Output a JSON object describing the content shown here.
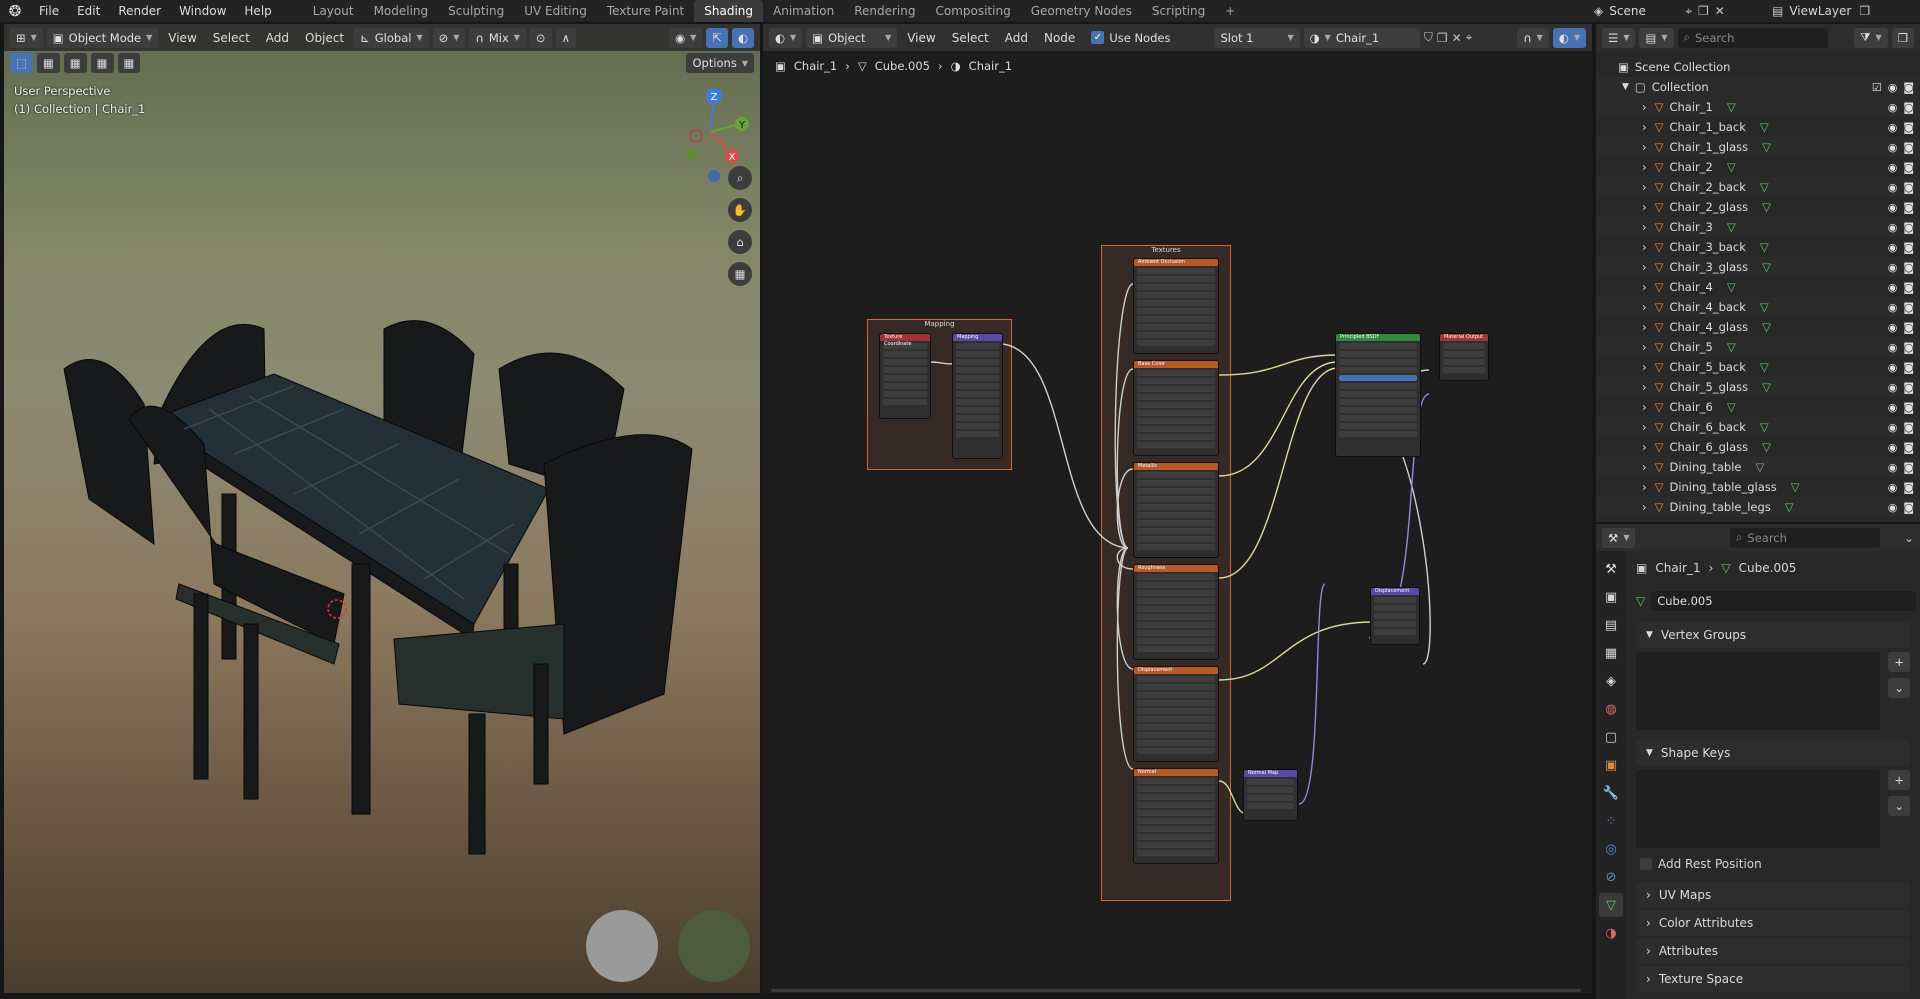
{
  "topbar": {
    "menus": [
      "File",
      "Edit",
      "Render",
      "Window",
      "Help"
    ],
    "workspaces": [
      "Layout",
      "Modeling",
      "Sculpting",
      "UV Editing",
      "Texture Paint",
      "Shading",
      "Animation",
      "Rendering",
      "Compositing",
      "Geometry Nodes",
      "Scripting"
    ],
    "active_workspace": "Shading",
    "add_tab": "+",
    "scene": "Scene",
    "view_layer": "ViewLayer"
  },
  "viewport": {
    "mode": "Object Mode",
    "menus": [
      "View",
      "Select",
      "Add",
      "Object"
    ],
    "orientation": "Global",
    "pivot": "Mix",
    "options": "Options",
    "perspective": "User Perspective",
    "collection_info": "(1) Collection | Chair_1",
    "gizmo": {
      "x": "X",
      "y": "Y",
      "z": "Z"
    }
  },
  "node_editor": {
    "object": "Object",
    "menus": [
      "View",
      "Select",
      "Add",
      "Node"
    ],
    "use_nodes_label": "Use Nodes",
    "slot": "Slot 1",
    "material": "Chair_1",
    "breadcrumb": [
      "Chair_1",
      "Cube.005",
      "Chair_1"
    ],
    "frames": {
      "mapping": "Mapping",
      "textures": "Textures"
    },
    "nodes": {
      "tex_coord": "Texture Coordinate",
      "mapping": "Mapping",
      "tex_titles": [
        "Ambient Occlusion",
        "Base Color",
        "Metallic",
        "Roughness",
        "Displacement",
        "Normal"
      ],
      "bsdf": "Principled BSDF",
      "output": "Material Output",
      "displacement": "Displacement",
      "normal_map": "Normal Map"
    }
  },
  "outliner": {
    "search_placeholder": "Search",
    "scene_collection": "Scene Collection",
    "collection": "Collection",
    "items": [
      "Chair_1",
      "Chair_1_back",
      "Chair_1_glass",
      "Chair_2",
      "Chair_2_back",
      "Chair_2_glass",
      "Chair_3",
      "Chair_3_back",
      "Chair_3_glass",
      "Chair_4",
      "Chair_4_back",
      "Chair_4_glass",
      "Chair_5",
      "Chair_5_back",
      "Chair_5_glass",
      "Chair_6",
      "Chair_6_back",
      "Chair_6_glass",
      "Dining_table",
      "Dining_table_glass",
      "Dining_table_legs"
    ]
  },
  "properties": {
    "search_placeholder": "Search",
    "breadcrumb": [
      "Chair_1",
      "Cube.005"
    ],
    "mesh_name": "Cube.005",
    "panels": {
      "vertex_groups": "Vertex Groups",
      "shape_keys": "Shape Keys",
      "add_rest_position": "Add Rest Position",
      "uv_maps": "UV Maps",
      "color_attributes": "Color Attributes",
      "attributes": "Attributes",
      "texture_space": "Texture Space"
    }
  },
  "colors": {
    "accent": "#4772b3",
    "frame_border": "#e0642a",
    "object_icon": "#e58a3a",
    "mesh_icon": "#6cc36c",
    "active_tab": "#3b3b3b"
  }
}
